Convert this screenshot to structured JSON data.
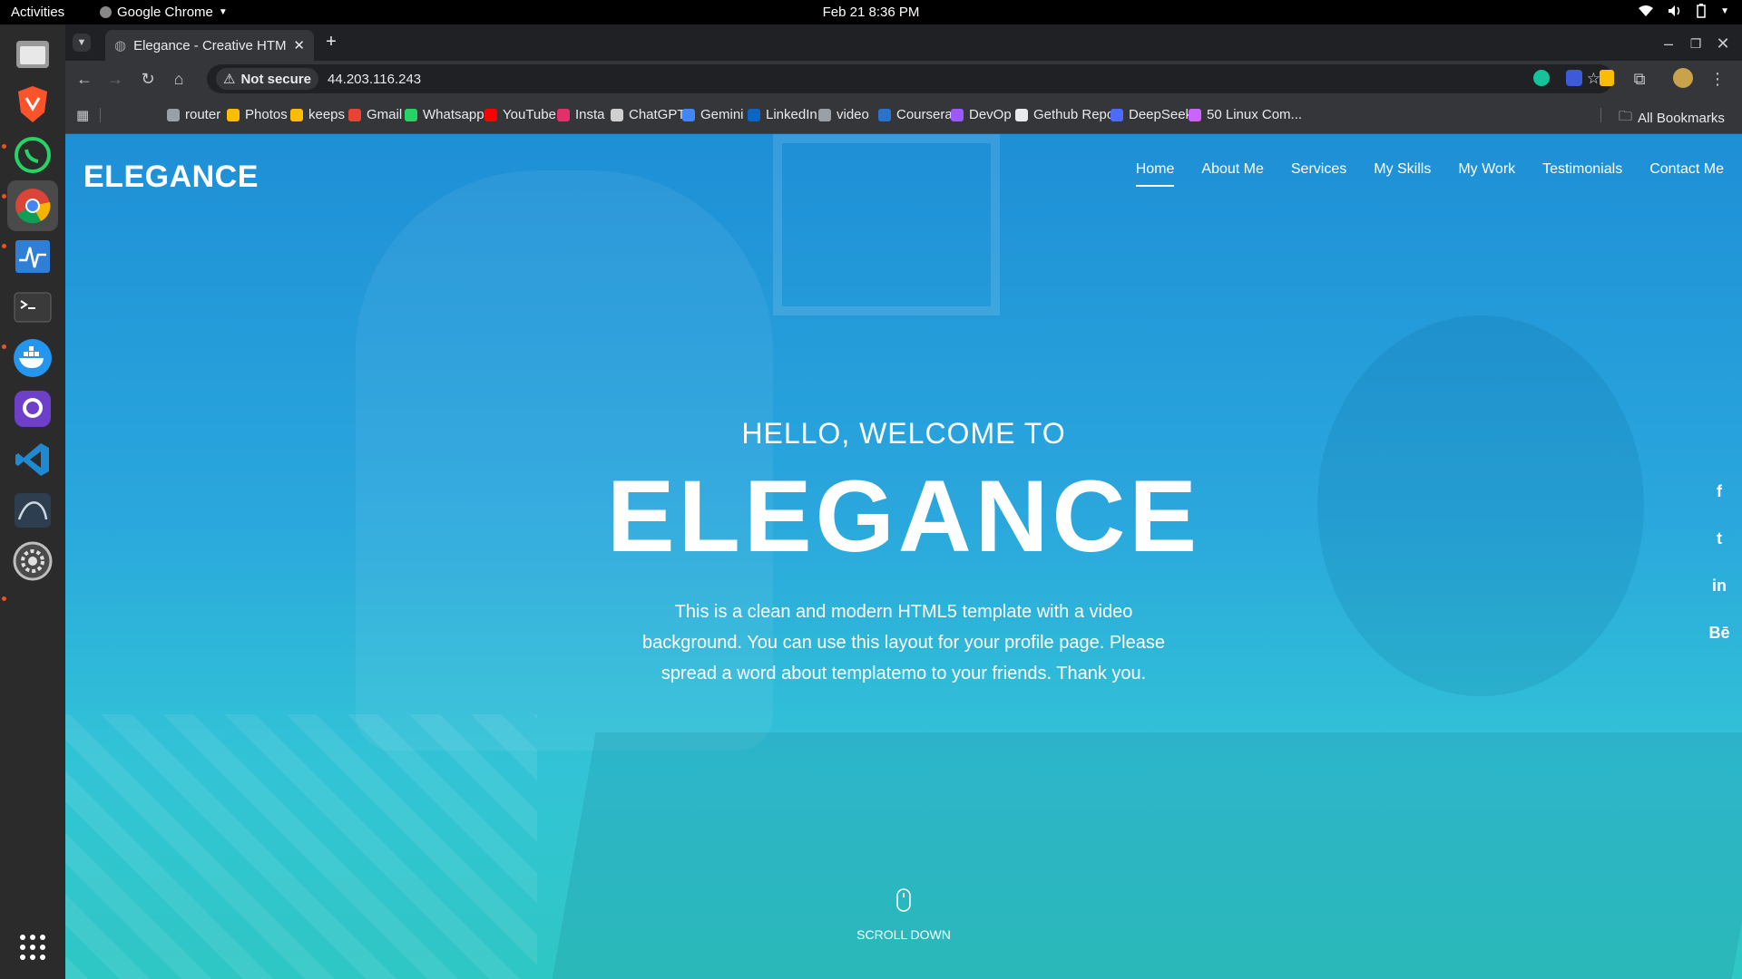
{
  "topbar": {
    "activities": "Activities",
    "app": "Google Chrome",
    "clock": "Feb 21  8:36 PM"
  },
  "browser": {
    "tab_title": "Elegance - Creative HTML",
    "security": "Not secure",
    "url": "44.203.116.243",
    "bookmarks": [
      {
        "label": "router",
        "color": "#9aa0a6"
      },
      {
        "label": "Photos",
        "color": "#fbbc04"
      },
      {
        "label": "keeps",
        "color": "#fbbc04"
      },
      {
        "label": "Gmail",
        "color": "#ea4335"
      },
      {
        "label": "Whatsapp",
        "color": "#25d366"
      },
      {
        "label": "YouTube",
        "color": "#ff0000"
      },
      {
        "label": "Insta",
        "color": "#e1306c"
      },
      {
        "label": "ChatGPT",
        "color": "#d0d0d0"
      },
      {
        "label": "Gemini",
        "color": "#4285f4"
      },
      {
        "label": "LinkedIn",
        "color": "#0a66c2"
      },
      {
        "label": "video",
        "color": "#9aa0a6"
      },
      {
        "label": "Coursera",
        "color": "#2a73cc"
      },
      {
        "label": "DevOp",
        "color": "#9b59ff"
      },
      {
        "label": "Gethub Repo",
        "color": "#e8eaed"
      },
      {
        "label": "DeepSeek",
        "color": "#4d6bfe"
      },
      {
        "label": "50 Linux Com...",
        "color": "#c964ff"
      }
    ],
    "all_bookmarks": "All Bookmarks"
  },
  "site": {
    "brand": "ELEGANCE",
    "nav": [
      "Home",
      "About Me",
      "Services",
      "My Skills",
      "My Work",
      "Testimonials",
      "Contact Me"
    ],
    "active_nav": "Home",
    "hero_sub": "HELLO, WELCOME TO",
    "hero_title": "ELEGANCE",
    "hero_desc": "This is a clean and modern HTML5 template with a video background. You can use this layout for your profile page. Please spread a word about templatemo to your friends. Thank you.",
    "scroll_label": "SCROLL DOWN",
    "social": [
      "f",
      "t",
      "in",
      "Bē"
    ]
  }
}
